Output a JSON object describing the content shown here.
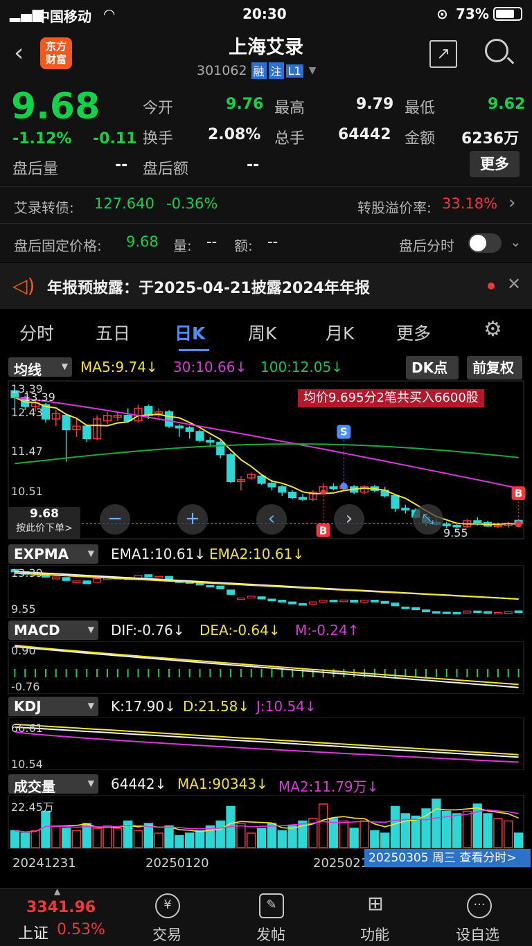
{
  "status_bar": {
    "carrier": "中国移动",
    "time": "20:30",
    "battery": "73%"
  },
  "header": {
    "logo_line1": "东方",
    "logo_line2": "财富",
    "title": "上海艾录",
    "code": "301062",
    "tag1": "融",
    "tag2": "注",
    "tag3": "L1"
  },
  "quote": {
    "price": "9.68",
    "change_pct": "-1.12%",
    "change": "-0.11",
    "open_label": "今开",
    "open": "9.76",
    "high_label": "最高",
    "high": "9.79",
    "low_label": "最低",
    "low": "9.62",
    "turnover_label": "换手",
    "turnover": "2.08%",
    "volume_label": "总手",
    "volume": "64442",
    "amount_label": "金额",
    "amount": "6236万",
    "after_vol_label": "盘后量",
    "after_vol": "--",
    "after_amt_label": "盘后额",
    "after_amt": "--",
    "more_button": "更多"
  },
  "bond": {
    "name": "艾录转债:",
    "price": "127.640",
    "change": "-0.36%",
    "premium_label": "转股溢价率:",
    "premium": "33.18%"
  },
  "after_hours": {
    "label": "盘后固定价格:",
    "price": "9.68",
    "vol_label": "量:",
    "vol": "--",
    "amt_label": "额:",
    "amt": "--",
    "toggle_label": "盘后分时",
    "toggle_on": false
  },
  "notice": {
    "text": "年报预披露：于2025-04-21披露2024年年报"
  },
  "tabs": [
    "分时",
    "五日",
    "日K",
    "周K",
    "月K",
    "更多"
  ],
  "active_tab": "日K",
  "kline": {
    "ma_selector": "均线",
    "ma5": "MA5:9.74↓",
    "ma30": "30:10.66↓",
    "ma100": "100:12.05↓",
    "dk_button": "DK点",
    "fq_button": "前复权",
    "banner": "均价9.695分2笔共买入6600股",
    "y_labels": [
      "13.39",
      "12.43",
      "11.47",
      "10.51"
    ],
    "high_marker": "13.39",
    "low_marker": "9.55",
    "price_tag": "9.68",
    "price_tag_sub": "按此价下单>",
    "marker_s": "S",
    "marker_b": "B"
  },
  "expma": {
    "label": "EXPMA",
    "ema1": "EMA1:10.61↓",
    "ema2": "EMA2:10.61↓",
    "y_top": "13.39",
    "y_bottom": "9.55"
  },
  "macd": {
    "label": "MACD",
    "dif": "DIF:-0.76↓",
    "dea": "DEA:-0.64↓",
    "m": "M:-0.24↑",
    "y_top": "0.90",
    "y_bottom": "-0.76"
  },
  "kdj": {
    "label": "KDJ",
    "k": "K:17.90↓",
    "d": "D:21.58↓",
    "j": "J:10.54↓",
    "y_top": "66.61",
    "y_bottom": "10.54"
  },
  "volume": {
    "label": "成交量",
    "vol": "64442↓",
    "ma1": "MA1:90343↓",
    "ma2": "MA2:11.79万↓",
    "y_top": "22.45万"
  },
  "dates": [
    "20241231",
    "20250120",
    "20250211"
  ],
  "date_tooltip": "20250305 周三 查看分时>",
  "bottom_nav": {
    "index_value": "3341.96",
    "index_name": "上证",
    "index_change": "0.53%",
    "items": [
      "交易",
      "发帖",
      "功能",
      "设自选"
    ]
  },
  "colors": {
    "up": "#f0383c",
    "down": "#14d14a",
    "cyan": "#2fd6d6",
    "ma5": "#f2e33a",
    "ma30": "#d93ad9",
    "ma100": "#22a83a"
  },
  "chart_data": {
    "type": "bar",
    "categories": [],
    "candles": [
      [
        13.39,
        13.2,
        13.39,
        12.9
      ],
      [
        13.2,
        12.95,
        13.25,
        12.85
      ],
      [
        12.95,
        13.05,
        13.15,
        12.8
      ],
      [
        13.0,
        12.6,
        13.05,
        12.5
      ],
      [
        12.6,
        12.75,
        12.85,
        12.4
      ],
      [
        12.7,
        12.3,
        12.75,
        11.4
      ],
      [
        12.3,
        12.4,
        12.6,
        12.1
      ],
      [
        12.4,
        12.05,
        12.45,
        11.95
      ],
      [
        12.05,
        12.6,
        12.7,
        12.0
      ],
      [
        12.55,
        12.7,
        12.8,
        12.45
      ],
      [
        12.65,
        12.7,
        12.8,
        12.55
      ],
      [
        12.7,
        12.55,
        12.9,
        12.5
      ],
      [
        12.55,
        12.9,
        13.0,
        12.5
      ],
      [
        12.95,
        12.7,
        13.0,
        12.6
      ],
      [
        12.75,
        12.8,
        12.9,
        12.65
      ],
      [
        12.8,
        12.4,
        12.85,
        12.35
      ],
      [
        12.4,
        12.35,
        12.45,
        12.1
      ],
      [
        12.35,
        12.25,
        12.4,
        12.05
      ],
      [
        12.25,
        12.0,
        12.3,
        11.95
      ],
      [
        12.0,
        11.95,
        12.1,
        11.85
      ],
      [
        11.95,
        11.6,
        12.0,
        11.5
      ],
      [
        11.6,
        10.85,
        11.65,
        10.8
      ],
      [
        10.85,
        10.9,
        11.0,
        10.6
      ],
      [
        10.95,
        11.05,
        11.1,
        10.9
      ],
      [
        11.0,
        10.8,
        11.05,
        10.75
      ],
      [
        10.8,
        10.7,
        10.9,
        10.6
      ],
      [
        10.7,
        10.55,
        10.75,
        10.45
      ],
      [
        10.55,
        10.4,
        10.6,
        10.35
      ],
      [
        10.4,
        10.35,
        10.5,
        10.3
      ],
      [
        10.35,
        10.55,
        10.6,
        10.3
      ],
      [
        10.55,
        10.7,
        10.8,
        10.5
      ],
      [
        10.7,
        10.65,
        10.8,
        10.6
      ],
      [
        10.65,
        10.72,
        10.85,
        10.6
      ],
      [
        10.7,
        10.55,
        10.75,
        10.5
      ],
      [
        10.55,
        10.7,
        10.75,
        10.5
      ],
      [
        10.7,
        10.6,
        10.75,
        10.55
      ],
      [
        10.6,
        10.45,
        10.7,
        10.4
      ],
      [
        10.45,
        10.1,
        10.5,
        10.0
      ],
      [
        10.1,
        10.05,
        10.2,
        9.95
      ],
      [
        10.05,
        9.85,
        10.1,
        9.8
      ],
      [
        9.85,
        9.7,
        9.9,
        9.6
      ],
      [
        9.7,
        9.65,
        9.8,
        9.6
      ],
      [
        9.65,
        9.62,
        9.72,
        9.55
      ],
      [
        9.62,
        9.58,
        9.7,
        9.55
      ],
      [
        9.58,
        9.75,
        9.8,
        9.55
      ],
      [
        9.75,
        9.7,
        9.85,
        9.62
      ],
      [
        9.7,
        9.6,
        9.75,
        9.58
      ],
      [
        9.6,
        9.62,
        9.7,
        9.55
      ],
      [
        9.62,
        9.68,
        9.72,
        9.55
      ],
      [
        9.76,
        9.68,
        9.79,
        9.62
      ]
    ],
    "ylim": [
      9.4,
      13.55
    ]
  }
}
